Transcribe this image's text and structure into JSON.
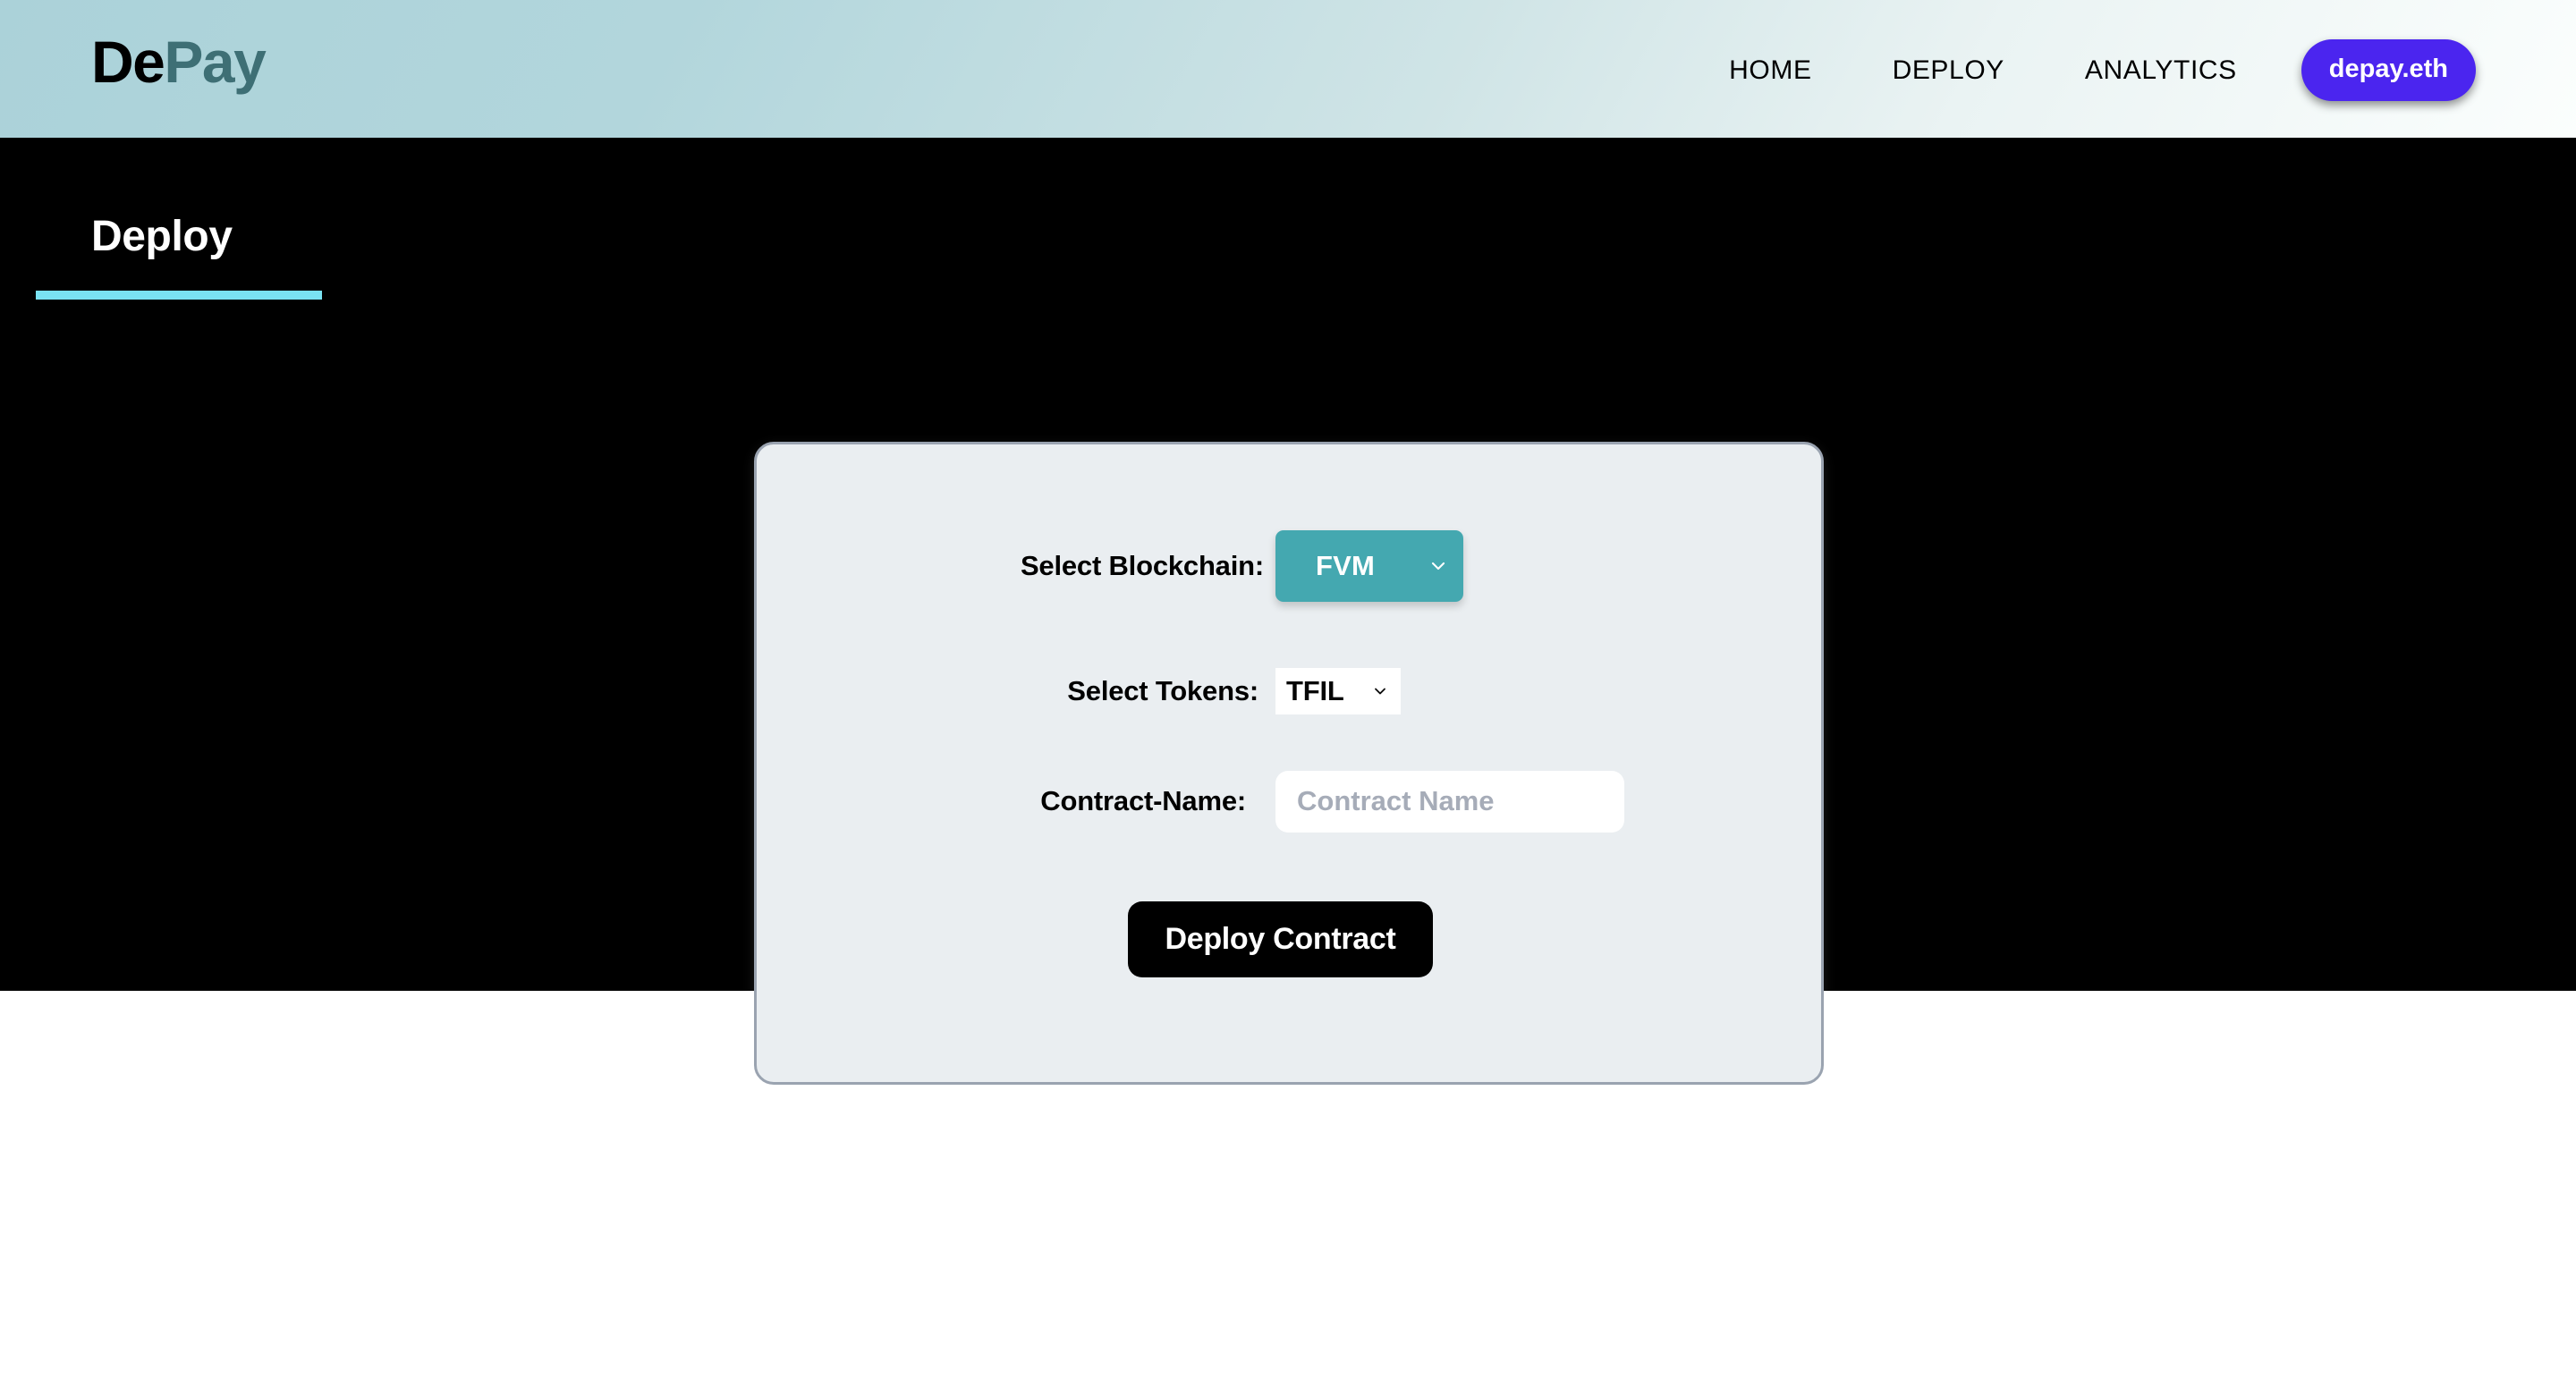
{
  "header": {
    "brand": {
      "part_dark": "De",
      "part_accent": "Pay"
    },
    "nav": [
      {
        "id": "home",
        "label": "HOME"
      },
      {
        "id": "deploy",
        "label": "DEPLOY"
      },
      {
        "id": "analytics",
        "label": "ANALYTICS"
      }
    ],
    "wallet": {
      "label": "depay.eth"
    },
    "colors": {
      "brand_dark": "#000000",
      "brand_accent": "#3e6f75",
      "wallet_bg": "#4b25ef",
      "gradient_start": "#abd2d9",
      "gradient_end": "#fbfefd"
    }
  },
  "page": {
    "title": "Deploy",
    "underline_color": "#79e2f2",
    "background": "#000000"
  },
  "card": {
    "background": "#eaeef1",
    "border_color": "#9aa3b0",
    "fields": {
      "blockchain": {
        "label": "Select Blockchain:",
        "selected": "FVM",
        "chevron_icon": "chevron-down-icon",
        "accent": "#44a8b0"
      },
      "tokens": {
        "label": "Select Tokens:",
        "selected": "TFIL",
        "chevron_icon": "chevron-down-icon"
      },
      "contract_name": {
        "label": "Contract-Name:",
        "value": "",
        "placeholder": "Contract Name"
      }
    },
    "submit": {
      "label": "Deploy Contract",
      "background": "#000000"
    }
  }
}
